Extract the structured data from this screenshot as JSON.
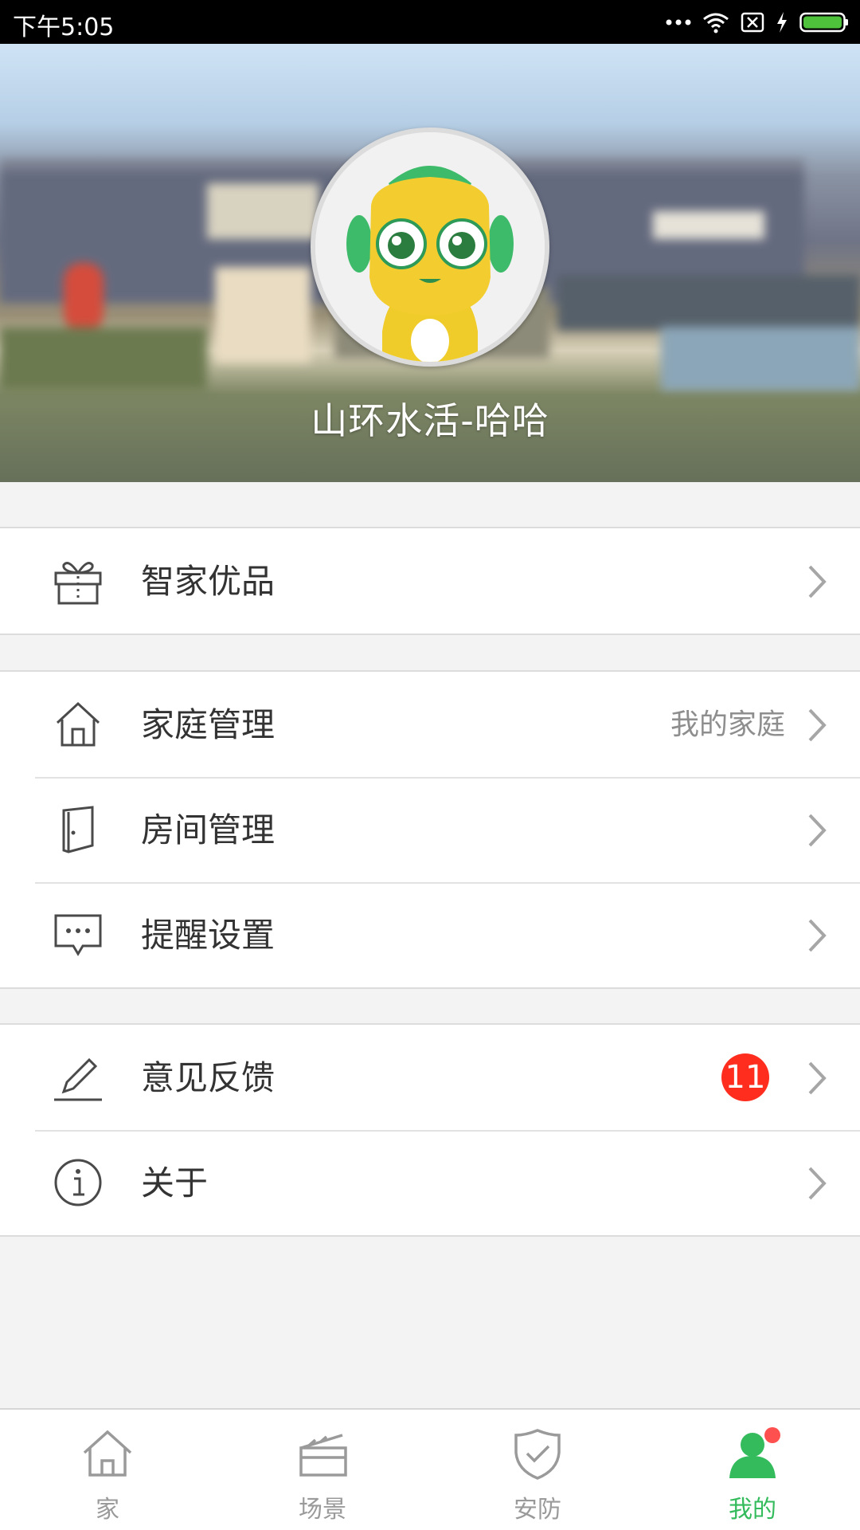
{
  "status_bar": {
    "time": "下午5:05"
  },
  "profile": {
    "username": "山环水活-哈哈"
  },
  "groups": [
    {
      "items": [
        {
          "label": "智家优品",
          "icon": "gift-icon"
        }
      ]
    },
    {
      "items": [
        {
          "label": "家庭管理",
          "icon": "house-icon",
          "value": "我的家庭"
        },
        {
          "label": "房间管理",
          "icon": "door-icon"
        },
        {
          "label": "提醒设置",
          "icon": "message-icon"
        }
      ]
    },
    {
      "items": [
        {
          "label": "意见反馈",
          "icon": "pen-icon",
          "badge": "11"
        },
        {
          "label": "关于",
          "icon": "info-icon"
        }
      ]
    }
  ],
  "tabs": [
    {
      "label": "家",
      "icon": "home-icon"
    },
    {
      "label": "场景",
      "icon": "clapperboard-icon"
    },
    {
      "label": "安防",
      "icon": "shield-icon"
    },
    {
      "label": "我的",
      "icon": "person-icon",
      "active": true
    }
  ],
  "colors": {
    "accent": "#33bb5c",
    "badge": "#ff2d1e"
  }
}
